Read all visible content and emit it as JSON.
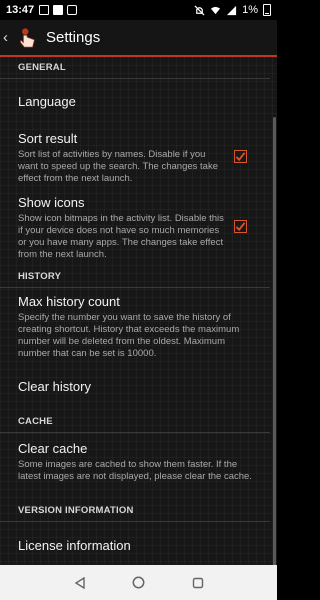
{
  "status": {
    "time": "13:47",
    "battery": "1%"
  },
  "header": {
    "title": "Settings",
    "back_glyph": "‹"
  },
  "sections": {
    "general": "GENERAL",
    "history": "HISTORY",
    "cache": "CACHE",
    "version": "VERSION INFORMATION"
  },
  "items": {
    "language": {
      "title": "Language"
    },
    "sort_result": {
      "title": "Sort result",
      "summary": "Sort list of activities by names. Disable if you want to speed up the search. The changes take effect from the next launch.",
      "checked": true
    },
    "show_icons": {
      "title": "Show icons",
      "summary": "Show icon bitmaps in the activity list. Disable this if your device does not have so much memories or you have many apps. The changes take effect from the next launch.",
      "checked": true
    },
    "max_history": {
      "title": "Max history count",
      "summary": "Specify the number you want to save the history of creating shortcut. History that exceeds the maximum number will be deleted from the oldest. Maximum number that can be set is 10000."
    },
    "clear_history": {
      "title": "Clear history"
    },
    "clear_cache": {
      "title": "Clear cache",
      "summary": "Some images are cached to show them faster. If the latest images are not displayed, please clear the cache."
    },
    "license": {
      "title": "License information"
    }
  },
  "colors": {
    "accent": "#c0391c",
    "checkbox": "#d6562b",
    "background": "#171717"
  },
  "icons": {
    "app": "hand-pointer-icon",
    "back": "back-arrow-icon",
    "nav_back": "triangle-back-icon",
    "nav_home": "circle-home-icon",
    "nav_recents": "square-recents-icon"
  }
}
